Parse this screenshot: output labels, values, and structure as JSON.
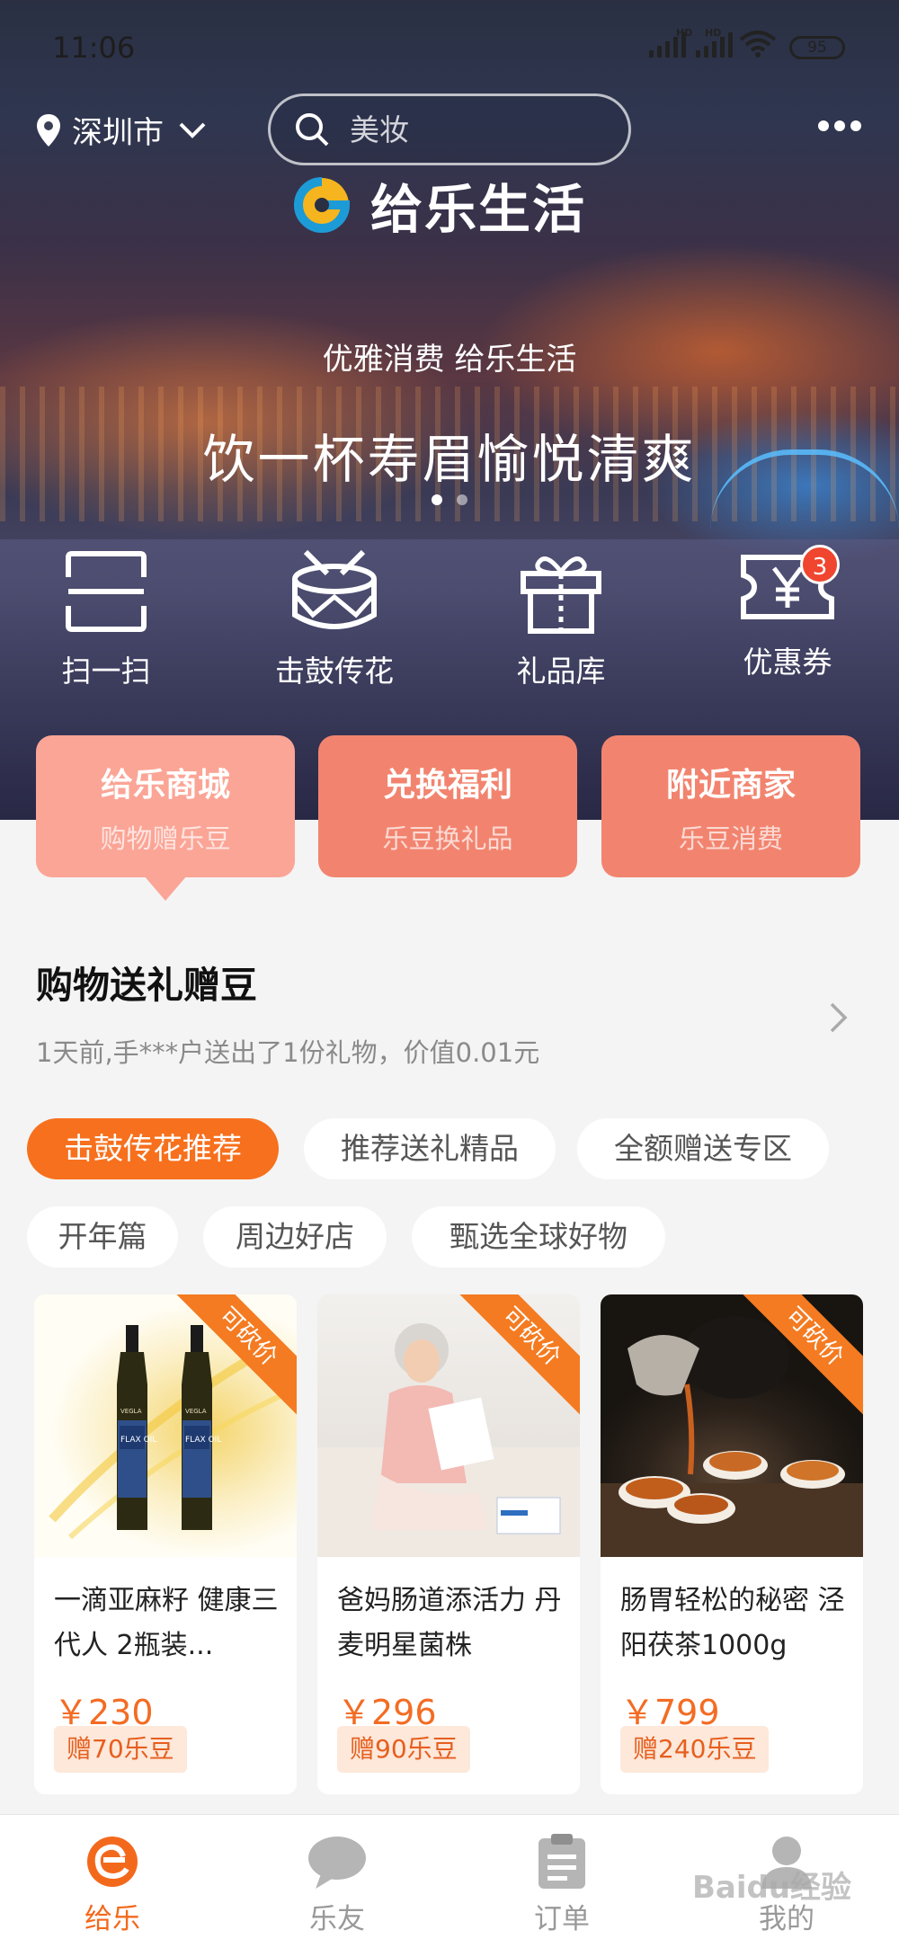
{
  "status_bar": {
    "time": "11:06",
    "battery": "95",
    "hd1": "HD",
    "hd2": "HD"
  },
  "header": {
    "city": "深圳市",
    "search_placeholder": "美妆"
  },
  "brand": {
    "name": "给乐生活"
  },
  "banner": {
    "slogan": "优雅消费 给乐生活",
    "title": "饮一杯寿眉愉悦清爽",
    "slides": 2,
    "active_slide": 1
  },
  "quick_actions": [
    {
      "label": "扫一扫",
      "icon": "scan-icon"
    },
    {
      "label": "击鼓传花",
      "icon": "drum-icon"
    },
    {
      "label": "礼品库",
      "icon": "gift-icon"
    },
    {
      "label": "优惠券",
      "icon": "coupon-icon",
      "badge": "3"
    }
  ],
  "tabs": [
    {
      "title": "给乐商城",
      "subtitle": "购物赠乐豆",
      "active": true
    },
    {
      "title": "兑换福利",
      "subtitle": "乐豆换礼品",
      "active": false
    },
    {
      "title": "附近商家",
      "subtitle": "乐豆消费",
      "active": false
    }
  ],
  "section": {
    "title": "购物送礼赠豆",
    "subtitle": "1天前,手***户送出了1份礼物，价值0.01元"
  },
  "chips": [
    {
      "label": "击鼓传花推荐",
      "active": true
    },
    {
      "label": "推荐送礼精品",
      "active": false
    },
    {
      "label": "全额赠送专区",
      "active": false
    },
    {
      "label": "开年篇",
      "active": false
    },
    {
      "label": "周边好店",
      "active": false
    },
    {
      "label": "甄选全球好物",
      "active": false
    }
  ],
  "products": [
    {
      "title": "一滴亚麻籽 健康三代人 2瓶装...",
      "price": "￥230",
      "bean": "赠70乐豆",
      "ribbon": "可砍价",
      "label_text": "FLAX OIL",
      "brand_text": "VEGLA"
    },
    {
      "title": "爸妈肠道添活力 丹麦明星菌株",
      "price": "￥296",
      "bean": "赠90乐豆",
      "ribbon": "可砍价"
    },
    {
      "title": "肠胃轻松的秘密 泾阳茯茶1000g",
      "price": "￥799",
      "bean": "赠240乐豆",
      "ribbon": "可砍价"
    }
  ],
  "bottom_nav": [
    {
      "label": "给乐",
      "active": true
    },
    {
      "label": "乐友",
      "active": false
    },
    {
      "label": "订单",
      "active": false
    },
    {
      "label": "我的",
      "active": false
    }
  ],
  "watermark": "Baidu经验",
  "colors": {
    "accent": "#f7701d",
    "price": "#f36c24",
    "tab": "#f2846f",
    "tab_active": "#fba596"
  }
}
